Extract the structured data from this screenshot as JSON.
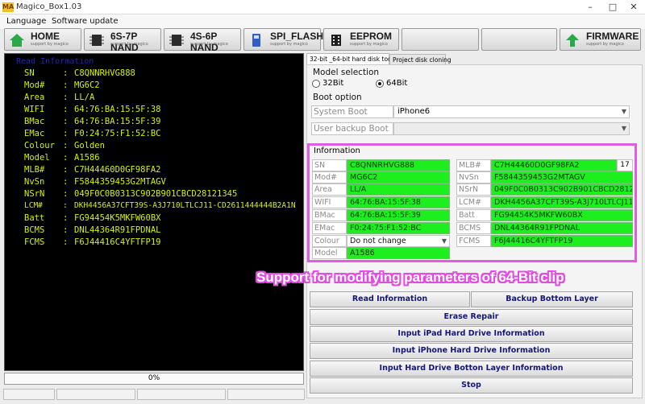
{
  "window": {
    "title": "Magico_Box1.03",
    "app_icon_text": "MA",
    "controls": [
      "–",
      "□",
      "✕"
    ]
  },
  "menu": [
    "Language",
    "Software update"
  ],
  "toolbar": [
    {
      "label": "HOME",
      "sub": "support by magico",
      "icon": "home-icon"
    },
    {
      "label": "6S-7P NAND",
      "sub": "support by magico",
      "icon": "chip-icon"
    },
    {
      "label": "4S-6P NAND",
      "sub": "support by magico",
      "icon": "chip-icon"
    },
    {
      "label": "SPI_FLASH",
      "sub": "support by magico",
      "icon": "flash-icon"
    },
    {
      "label": "EEPROM",
      "sub": "support by magico",
      "icon": "eeprom-icon"
    },
    {
      "label": "",
      "sub": "",
      "icon": ""
    },
    {
      "label": "",
      "sub": "",
      "icon": ""
    },
    {
      "label": "FIRMWARE",
      "sub": "support by magico",
      "icon": "up-arrow-icon"
    }
  ],
  "terminal": {
    "header": "Read Information",
    "rows": [
      {
        "key": "SN",
        "sep": ":",
        "value": "C8QNNRHVG888"
      },
      {
        "key": "Mod#",
        "sep": ":",
        "value": "MG6C2"
      },
      {
        "key": "Area",
        "sep": ":",
        "value": "LL/A"
      },
      {
        "key": "WIFI",
        "sep": ":",
        "value": "64:76:BA:15:5F:38"
      },
      {
        "key": "BMac",
        "sep": ":",
        "value": "64:76:BA:15:5F:39"
      },
      {
        "key": "EMac",
        "sep": ":",
        "value": "F0:24:75:F1:52:BC"
      },
      {
        "key": "Colour",
        "sep": ":",
        "value": "Golden"
      },
      {
        "key": "Model",
        "sep": ":",
        "value": "A1586"
      },
      {
        "key": "MLB#",
        "sep": ":",
        "value": "C7H44460D0GF98FA2"
      },
      {
        "key": "NvSn",
        "sep": ":",
        "value": "F5844359453G2MTAGV"
      },
      {
        "key": "NSrN",
        "sep": ":",
        "value": "049F0C0B0313C902B901CBCD28121345"
      },
      {
        "key": "LCM#",
        "sep": ":",
        "value": "DKH4456A37CFT39S-A3J710LTLCJ11-CD2611444444B2A1N"
      },
      {
        "key": "Batt",
        "sep": ":",
        "value": "FG94454K5MKFW60BX"
      },
      {
        "key": "BCMS",
        "sep": ":",
        "value": "DNL44364R91FPDNAL"
      },
      {
        "key": "FCMS",
        "sep": ":",
        "value": "F6J44416C4YFTFP19"
      }
    ]
  },
  "progress": {
    "text": "0%",
    "value": 0
  },
  "tabs": [
    "32-bit _64-bit hard disk tool",
    "Project disk cloning"
  ],
  "model_selection": {
    "title": "Model selection",
    "options": [
      "32Bit",
      "64Bit"
    ],
    "selected": "64Bit"
  },
  "boot_option": {
    "title": "Boot option",
    "system_boot_label": "System Boot",
    "system_boot_value": "iPhone6",
    "user_backup_label": "User backup Boot",
    "user_backup_value": ""
  },
  "information": {
    "title": "Information",
    "left": [
      {
        "label": "SN",
        "value": "C8QNNRHVG888"
      },
      {
        "label": "Mod#",
        "value": "MG6C2"
      },
      {
        "label": "Area",
        "value": "LL/A"
      },
      {
        "label": "WIFI",
        "value": "64:76:BA:15:5F:38"
      },
      {
        "label": "BMac",
        "value": "64:76:BA:15:5F:39"
      },
      {
        "label": "EMac",
        "value": "F0:24:75:F1:52:BC"
      }
    ],
    "colour_label": "Colour",
    "colour_value": "Do not change",
    "model_label": "Model",
    "model_value": "A1586",
    "right": [
      {
        "label": "MLB#",
        "value": "C7H44460D0GF98FA2"
      },
      {
        "label": "NvSn",
        "value": "F5844359453G2MTAGV"
      },
      {
        "label": "NSrN",
        "value": "049F0C0B0313C902B901CBCD28121345"
      },
      {
        "label": "LCM#",
        "value": "DKH4456A37CFT39S-A3J710LTLCJ11-CD2611444444B2A1N"
      },
      {
        "label": "Batt",
        "value": "FG94454K5MKFW60BX"
      },
      {
        "label": "BCMS",
        "value": "DNL44364R91FPDNAL"
      },
      {
        "label": "FCMS",
        "value": "F6J44416C4YFTFP19"
      }
    ],
    "mlb_count": "17"
  },
  "banner": "Support for modifying parameters of 64-Bit clip",
  "actions": {
    "read_information": "Read Information",
    "backup_bottom_layer": "Backup Bottom Layer",
    "erase_repair": "Erase Repair",
    "input_ipad": "Input iPad Hard Drive Information",
    "input_iphone": "Input iPhone Hard Drive Information",
    "input_bottom_layer": "Input Hard Drive Botton Layer Information",
    "stop": "Stop"
  },
  "colors": {
    "value_green": "#1dee1d",
    "highlight_magenta": "#e05ce0",
    "terminal_text": "#d6f000",
    "button_text": "#15157a"
  }
}
